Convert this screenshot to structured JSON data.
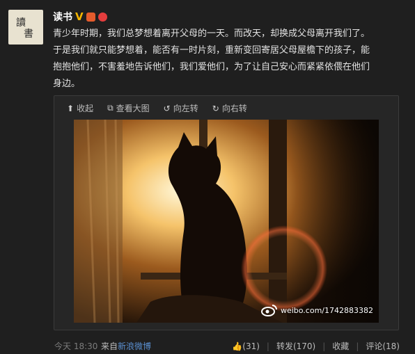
{
  "user": {
    "name": "读书",
    "avatar_glyphs": "读書",
    "verified_mark": "V"
  },
  "post": {
    "lines": [
      "青少年时期，我们总梦想着离开父母的一天。而改天，却换成父母离开我们了。",
      "于是我们就只能梦想着，能否有一时片刻，重新变回寄居父母屋檐下的孩子，能",
      "抱抱他们，不害羞地告诉他们，我们爱他们，为了让自己安心而紧紧依偎在他们",
      "身边。"
    ]
  },
  "media": {
    "toolbar": {
      "collapse": "收起",
      "view_large": "查看大图",
      "rotate_left": "向左转",
      "rotate_right": "向右转"
    },
    "watermark": "weibo.com/1742883382"
  },
  "footer": {
    "time": "今天 18:30",
    "from_prefix": "来自",
    "from_source": "新浪微博",
    "likes": "(31)",
    "repost": "转发(170)",
    "favorite": "收藏",
    "comment": "评论(18)",
    "separator": "|"
  },
  "colors": {
    "background": "#1f1f1f",
    "link": "#5a8fd0",
    "verified": "#f7b500"
  }
}
